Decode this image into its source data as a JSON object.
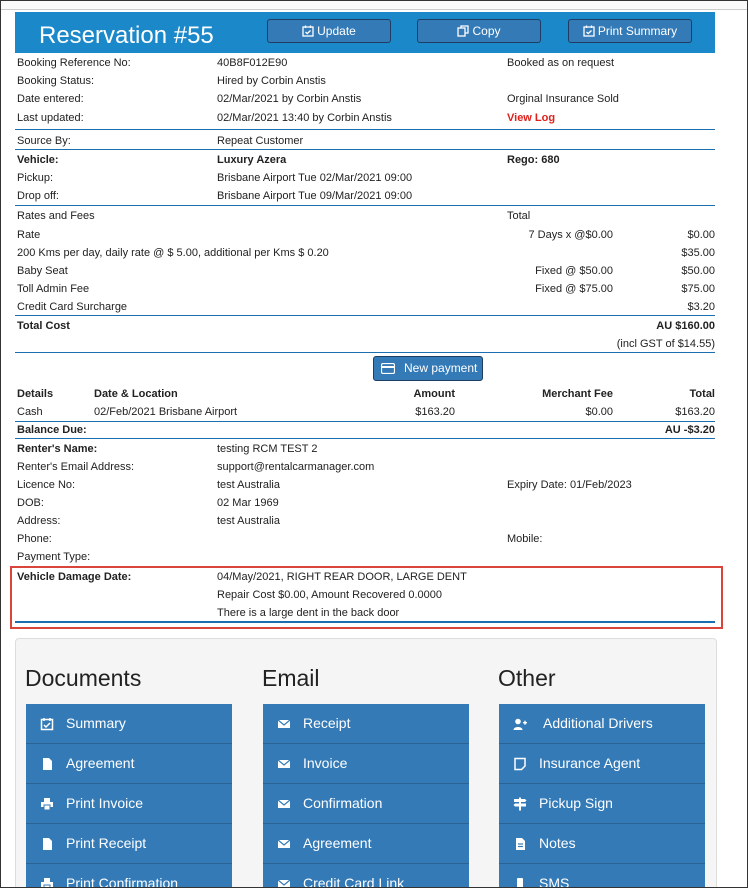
{
  "header": {
    "title": "Reservation #55",
    "update_label": "Update",
    "copy_label": "Copy",
    "print_summary_label": "Print Summary"
  },
  "booking": {
    "ref_label": "Booking Reference No:",
    "ref_value": "40B8F012E90",
    "ref_right": "Booked as on request",
    "status_label": "Booking Status:",
    "status_value": "Hired by Corbin Anstis",
    "entered_label": "Date entered:",
    "entered_value": "02/Mar/2021 by Corbin Anstis",
    "entered_right": "Orginal Insurance Sold",
    "updated_label": "Last updated:",
    "updated_value": "02/Mar/2021 13:40 by Corbin Anstis",
    "view_log": "View Log"
  },
  "source": {
    "label": "Source By:",
    "value": "Repeat Customer"
  },
  "vehicle": {
    "label": "Vehicle:",
    "value": "Luxury Azera",
    "rego": "Rego: 680",
    "pickup_label": "Pickup:",
    "pickup_value": "Brisbane Airport Tue 02/Mar/2021 09:00",
    "dropoff_label": "Drop off:",
    "dropoff_value": "Brisbane Airport Tue 09/Mar/2021 09:00"
  },
  "rates": {
    "heading": "Rates and Fees",
    "total_heading": "Total",
    "items": [
      {
        "name": "Rate",
        "calc": "7 Days x @$0.00",
        "amount": "$0.00"
      },
      {
        "name": "200 Kms per day, daily rate @ $ 5.00, additional per Kms $ 0.20",
        "calc": "",
        "amount": "$35.00"
      },
      {
        "name": "Baby Seat",
        "calc": "Fixed @ $50.00",
        "amount": "$50.00"
      },
      {
        "name": "Toll Admin Fee",
        "calc": "Fixed @ $75.00",
        "amount": "$75.00"
      },
      {
        "name": "Credit Card Surcharge",
        "calc": "",
        "amount": "$3.20"
      }
    ],
    "total_cost_label": "Total Cost",
    "total_cost_value": "AU $160.00",
    "gst_note": "(incl GST of $14.55)"
  },
  "payments": {
    "new_payment_label": "New payment",
    "headers": {
      "details": "Details",
      "date_location": "Date & Location",
      "amount": "Amount",
      "merchant_fee": "Merchant Fee",
      "total": "Total"
    },
    "rows": [
      {
        "details": "Cash",
        "date_location": "02/Feb/2021 Brisbane Airport",
        "amount": "$163.20",
        "merchant_fee": "$0.00",
        "total": "$163.20"
      }
    ],
    "balance_label": "Balance Due:",
    "balance_value": "AU -$3.20"
  },
  "renter": {
    "name_label": "Renter's Name:",
    "name_value": "testing RCM TEST 2",
    "email_label": "Renter's Email Address:",
    "email_value": "support@rentalcarmanager.com",
    "licence_label": "Licence No:",
    "licence_value": "test Australia",
    "expiry": "Expiry Date: 01/Feb/2023",
    "dob_label": "DOB:",
    "dob_value": "02 Mar 1969",
    "address_label": "Address:",
    "address_value": "test Australia",
    "phone_label": "Phone:",
    "mobile_label": "Mobile:",
    "payment_type_label": "Payment Type:"
  },
  "damage": {
    "label": "Vehicle Damage Date:",
    "line1": "04/May/2021, RIGHT REAR DOOR, LARGE DENT",
    "line2": "Repair Cost $0.00, Amount Recovered 0.0000",
    "line3": "There is a large dent in the back door"
  },
  "actions": {
    "documents": {
      "title": "Documents",
      "items": [
        "Summary",
        "Agreement",
        "Print Invoice",
        "Print Receipt",
        "Print Confirmation"
      ]
    },
    "email": {
      "title": "Email",
      "items": [
        "Receipt",
        "Invoice",
        "Confirmation",
        "Agreement",
        "Credit Card Link"
      ]
    },
    "other": {
      "title": "Other",
      "items": [
        "Additional Drivers",
        "Insurance Agent",
        "Pickup Sign",
        "Notes",
        "SMS"
      ]
    }
  },
  "colors": {
    "header_blue": "#1b88c9",
    "button_blue": "#337ab7",
    "link_red": "#e0201b",
    "highlight_border": "#d9453a"
  }
}
